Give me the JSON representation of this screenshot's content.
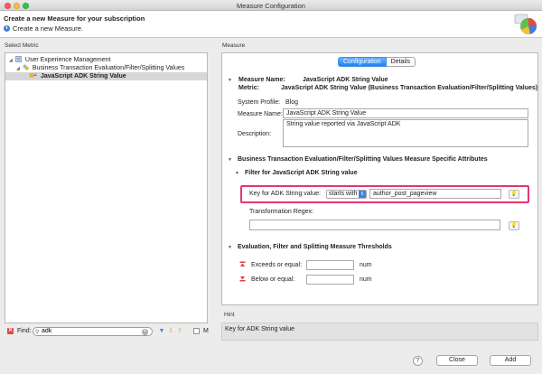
{
  "window": {
    "title": "Measure Configuration"
  },
  "header": {
    "title": "Create a new Measure for your subscription",
    "subtitle": "Create a new Measure.",
    "info_icon": "info-icon",
    "logo_icon": "measure-pie-logo"
  },
  "left": {
    "section_label": "Select Metric",
    "tree": [
      {
        "label": "User Experience Management",
        "level": 0,
        "expanded": true,
        "icon": "ux-icon"
      },
      {
        "label": "Business Transaction Evaluation/Filter/Splitting Values",
        "level": 1,
        "expanded": true,
        "icon": "bt-icon"
      },
      {
        "label": "JavaScript ADK String Value",
        "level": 2,
        "selected": true,
        "icon": "js-metric-icon"
      }
    ],
    "find": {
      "label": "Find:",
      "value": "adk",
      "trailing_label": "M"
    }
  },
  "right": {
    "section_label": "Measure",
    "tabs": [
      {
        "label": "Configuration",
        "active": true
      },
      {
        "label": "Details",
        "active": false
      }
    ],
    "measure": {
      "name_key": "Measure Name:",
      "name_value": "JavaScript ADK String Value",
      "metric_key": "Metric:",
      "metric_value": "JavaScript ADK String Value (Business Transaction Evaluation/Filter/Splitting Values)",
      "system_profile_key": "System Profile:",
      "system_profile_value": "Blog",
      "measure_name_key": "Measure Name:",
      "measure_name_field": "JavaScript ADK String Value",
      "description_key": "Description:",
      "description_field": "String value reported via JavaScript ADK"
    },
    "specific": {
      "heading": "Business Transaction Evaluation/Filter/Splitting Values Measure Specific Attributes",
      "filter_heading": "Filter for JavaScript ADK String value",
      "key_label": "Key for ADK String value:",
      "operator": "starts with",
      "key_value": "author_post_pageview",
      "regex_label": "Transformation Regex:",
      "regex_value": ""
    },
    "thresholds": {
      "heading": "Evaluation, Filter and Splitting Measure Thresholds",
      "exceeds_label": "Exceeds or equal:",
      "exceeds_value": "",
      "exceeds_unit": "num",
      "below_label": "Below or equal:",
      "below_value": "",
      "below_unit": "num"
    }
  },
  "hint": {
    "section_label": "Hint",
    "text": "Key for ADK String value"
  },
  "footer": {
    "help_label": "?",
    "close_label": "Close",
    "add_label": "Add"
  },
  "colors": {
    "accent": "#1a82f7",
    "highlight": "#e8356f"
  }
}
